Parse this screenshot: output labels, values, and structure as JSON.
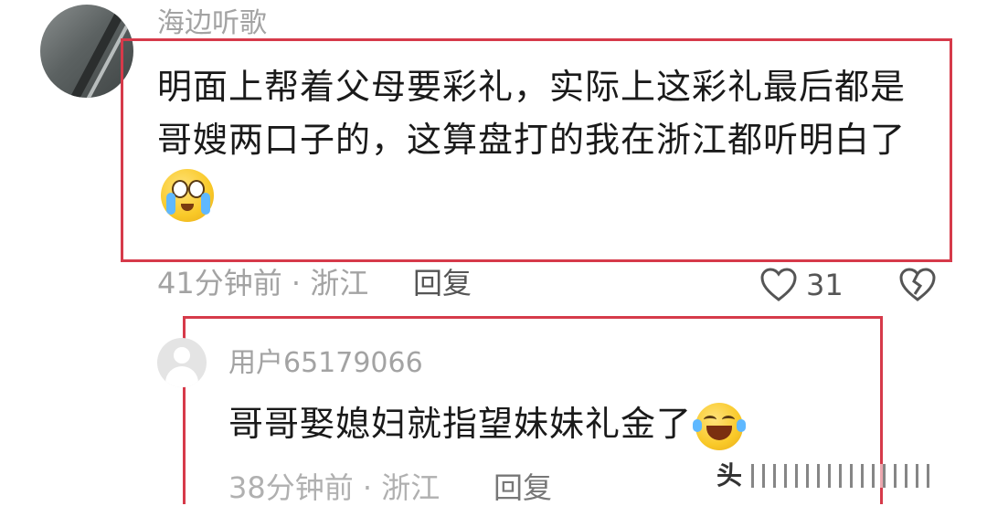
{
  "comment": {
    "username": "海边听歌",
    "text": "明面上帮着父母要彩礼，实际上这彩礼最后都是哥嫂两口子的，这算盘打的我在浙江都听明白了",
    "emoji": "crying-face-emoji",
    "time_location": "41分钟前 · 浙江",
    "reply_label": "回复",
    "like_count": "31"
  },
  "reply": {
    "username": "用户65179066",
    "text": "哥哥娶媳妇就指望妹妹礼金了",
    "emoji": "laughing-tears-emoji",
    "time_location": "38分钟前 · 浙江",
    "reply_label": "回复"
  },
  "watermark": {
    "text": "头"
  },
  "colors": {
    "highlight_border": "#d63a4a",
    "muted_text": "#a3a3a3"
  }
}
